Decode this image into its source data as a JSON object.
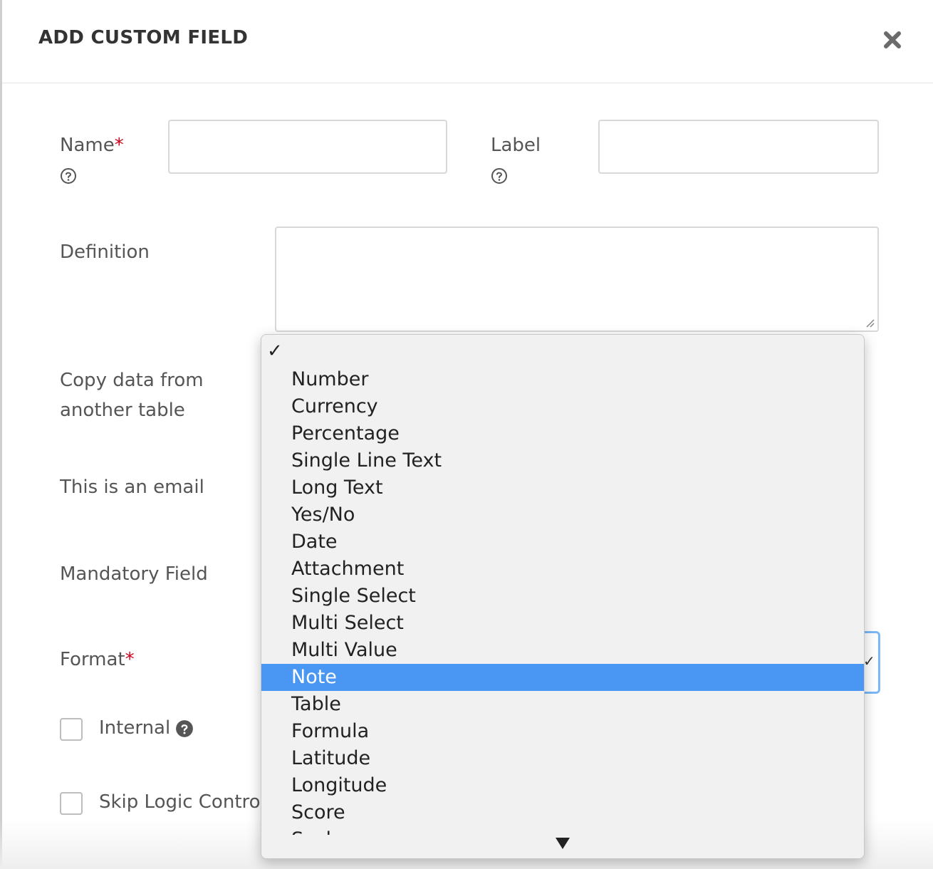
{
  "dialog": {
    "title": "ADD CUSTOM FIELD",
    "close_icon": "close-icon"
  },
  "form": {
    "name_label": "Name",
    "name_required": "*",
    "name_value": "",
    "label_label": "Label",
    "label_value": "",
    "definition_label": "Definition",
    "definition_value": "",
    "copy_label_line1": "Copy data from",
    "copy_label_line2": "another table",
    "email_label": "This is an email",
    "mandatory_label": "Mandatory Field",
    "format_label": "Format",
    "format_required": "*",
    "internal_label": "Internal",
    "skip_logic_label": "Skip Logic Contro",
    "help_icon": "help-circle-icon"
  },
  "format_dropdown": {
    "selected_value": "Note",
    "options": [
      "Number",
      "Currency",
      "Percentage",
      "Single Line Text",
      "Long Text",
      "Yes/No",
      "Date",
      "Attachment",
      "Single Select",
      "Multi Select",
      "Multi Value",
      "Note",
      "Table",
      "Formula",
      "Latitude",
      "Longitude",
      "Score",
      "Scale"
    ],
    "highlight_color": "#4a97f3"
  }
}
